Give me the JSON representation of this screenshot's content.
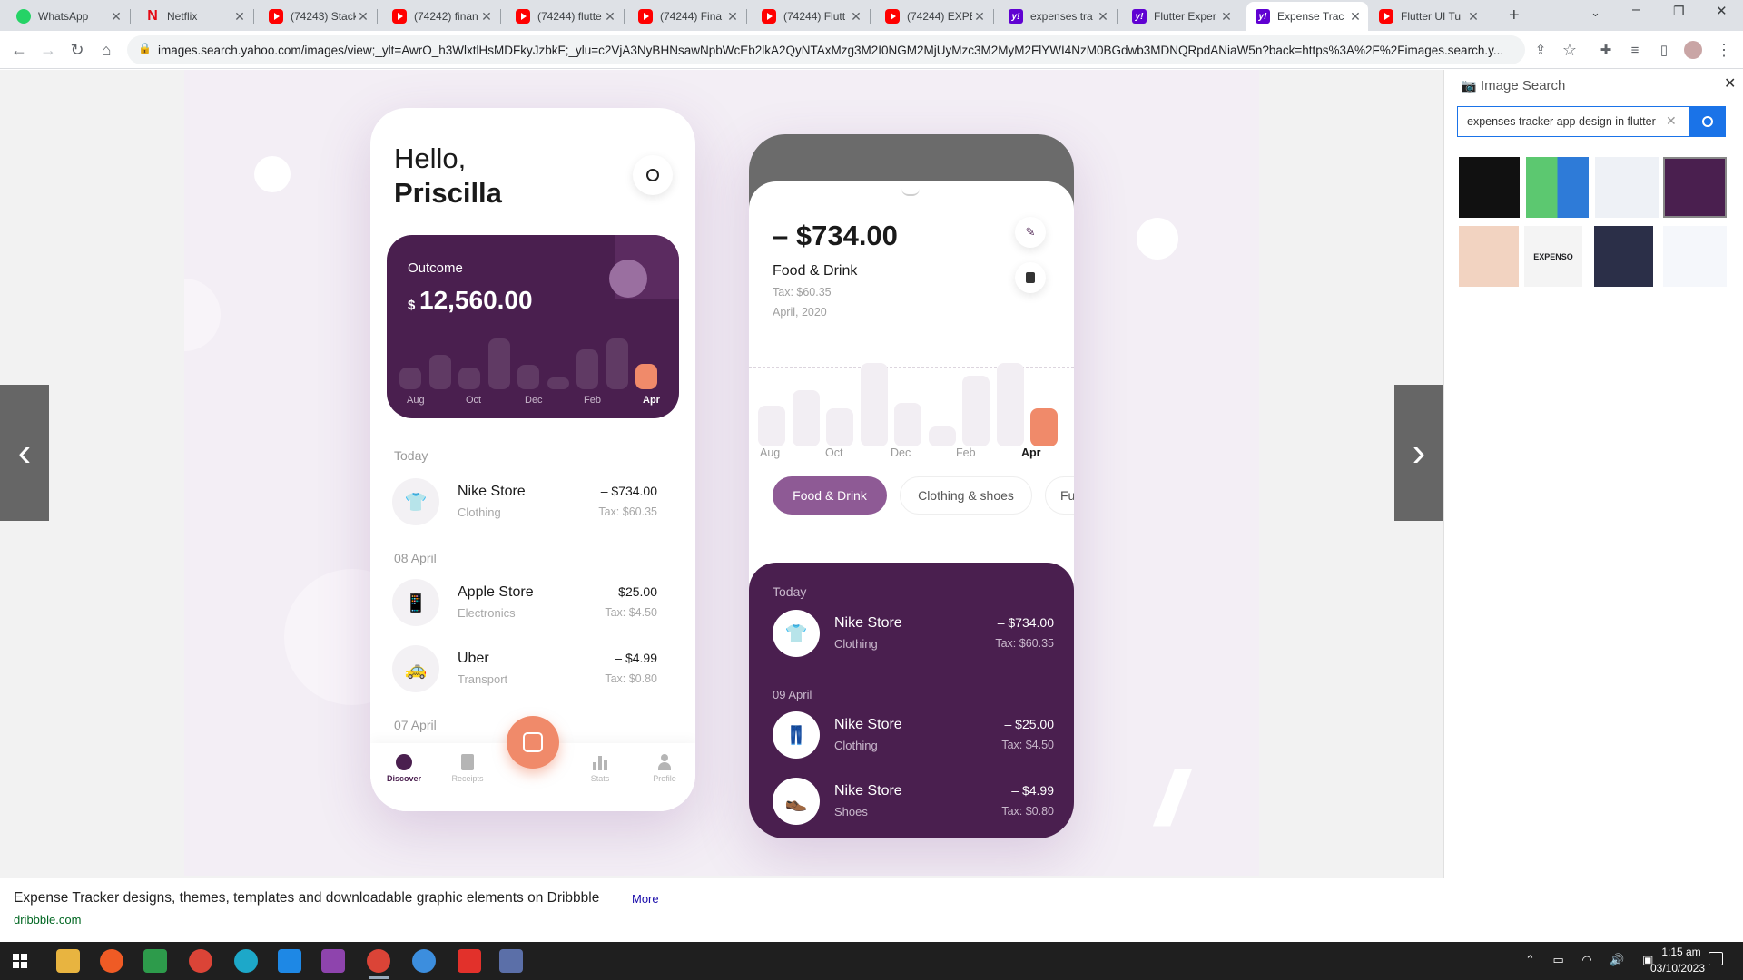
{
  "tabs": [
    {
      "title": "WhatsApp",
      "icon": "whatsapp-icon"
    },
    {
      "title": "Netflix",
      "icon": "netflix-icon"
    },
    {
      "title": "(74243) Stack",
      "icon": "youtube-icon"
    },
    {
      "title": "(74242) finan",
      "icon": "youtube-icon"
    },
    {
      "title": "(74244) flutte",
      "icon": "youtube-icon"
    },
    {
      "title": "(74244) Fina",
      "icon": "youtube-icon"
    },
    {
      "title": "(74244) Flutt",
      "icon": "youtube-icon"
    },
    {
      "title": "(74244) EXPE",
      "icon": "youtube-icon"
    },
    {
      "title": "expenses tra",
      "icon": "yahoo-icon"
    },
    {
      "title": "Flutter Exper",
      "icon": "yahoo-icon"
    },
    {
      "title": "Expense Trac",
      "icon": "yahoo-icon"
    },
    {
      "title": "Flutter UI Tu",
      "icon": "youtube-icon"
    }
  ],
  "url": "images.search.yahoo.com/images/view;_ylt=AwrO_h3WlxtlHsMDFkyJzbkF;_ylu=c2VjA3NyBHNsawNpbWcEb2lkA2QyNTAxMzg3M2I0NGM2MjUyMzc3M2MyM2FlYWI4NzM0BGdwb3MDNQRpdANiaW5n?back=https%3A%2F%2Fimages.search.y...",
  "side_panel": {
    "title": "Image Search",
    "query": "expenses tracker app design in flutter"
  },
  "caption": {
    "title": "Expense Tracker designs, themes, templates and downloadable graphic elements on Dribbble",
    "more": "More",
    "source": "dribbble.com"
  },
  "taskbar": {
    "time": "1:15 am",
    "date": "03/10/2023"
  },
  "app_left": {
    "greeting": "Hello,",
    "name": "Priscilla",
    "card_label": "Outcome",
    "currency": "$",
    "amount": "12,560.00",
    "months": [
      "Aug",
      "Oct",
      "Dec",
      "Feb",
      "Apr"
    ],
    "section_today": "Today",
    "section_1": "08 April",
    "section_2": "07 April",
    "transactions": [
      {
        "name": "Nike Store",
        "category": "Clothing",
        "amount": "– $734.00",
        "tax": "Tax: $60.35",
        "icon": "👕"
      },
      {
        "name": "Apple Store",
        "category": "Electronics",
        "amount": "– $25.00",
        "tax": "Tax: $4.50",
        "icon": "📱"
      },
      {
        "name": "Uber",
        "category": "Transport",
        "amount": "– $4.99",
        "tax": "Tax: $0.80",
        "icon": "🚕"
      }
    ],
    "nav": [
      "Discover",
      "Receipts",
      "Stats",
      "Profile"
    ]
  },
  "app_right": {
    "amount": "– $734.00",
    "title": "Food & Drink",
    "tax": "Tax: $60.35",
    "date": "April, 2020",
    "months": [
      "Aug",
      "Oct",
      "Dec",
      "Feb",
      "Apr"
    ],
    "chips": [
      "Food & Drink",
      "Clothing & shoes",
      "Fu"
    ],
    "section_today": "Today",
    "section_1": "09 April",
    "transactions": [
      {
        "name": "Nike Store",
        "category": "Clothing",
        "amount": "– $734.00",
        "tax": "Tax: $60.35",
        "icon": "👕"
      },
      {
        "name": "Nike Store",
        "category": "Clothing",
        "amount": "– $25.00",
        "tax": "Tax: $4.50",
        "icon": "👖"
      },
      {
        "name": "Nike Store",
        "category": "Shoes",
        "amount": "– $4.99",
        "tax": "Tax: $0.80",
        "icon": "👞"
      }
    ]
  },
  "colors": {
    "purple": "#4a1f4f",
    "accent": "#f08a6a",
    "chip": "#8e5a95"
  }
}
